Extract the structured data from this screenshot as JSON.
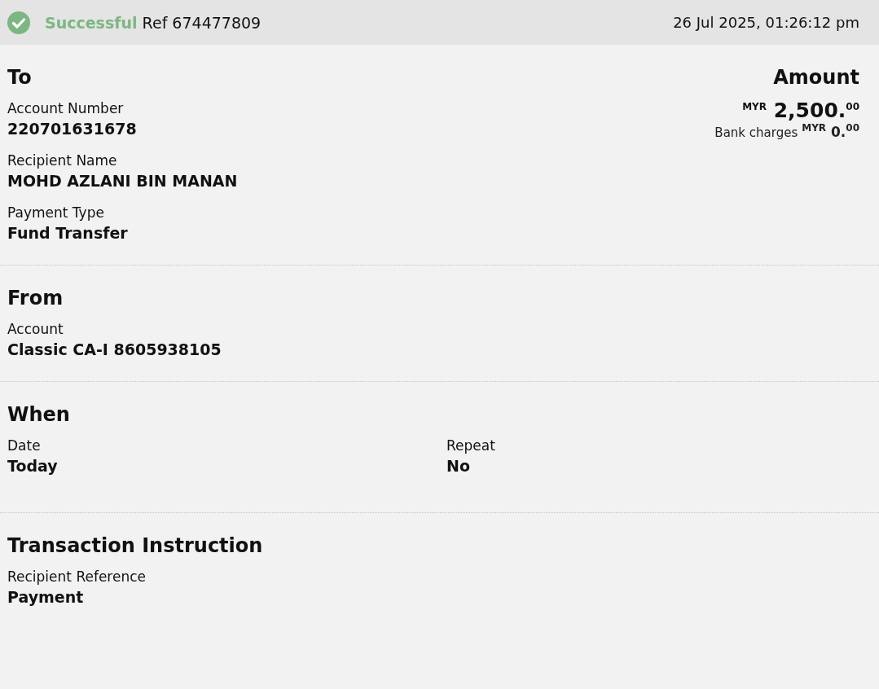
{
  "header": {
    "status": "Successful",
    "reference": "Ref 674477809",
    "timestamp": "26 Jul 2025, 01:26:12 pm"
  },
  "to": {
    "title": "To",
    "fields": [
      {
        "label": "Account Number",
        "value": "220701631678"
      },
      {
        "label": "Recipient Name",
        "value": "MOHD AZLANI BIN MANAN"
      },
      {
        "label": "Payment Type",
        "value": "Fund Transfer"
      }
    ],
    "amount": {
      "title": "Amount",
      "value": "$^{MYR}$ 2,500.$^{00}$",
      "bank_charges_label": "Bank charges",
      "bank_charges": "$^{MYR}$ 0.$^{00}$"
    }
  },
  "from": {
    "title": "From",
    "fields": [
      {
        "label": "Account",
        "value": "Classic CA-I 8605938105"
      }
    ]
  },
  "when": {
    "title": "When",
    "fields": [
      {
        "label": "Date",
        "value": "Today"
      },
      {
        "label": "Repeat",
        "value": "No"
      }
    ]
  },
  "instruction": {
    "title": "Transaction Instruction",
    "fields": [
      {
        "label": "Recipient Reference",
        "value": "Payment"
      }
    ]
  }
}
